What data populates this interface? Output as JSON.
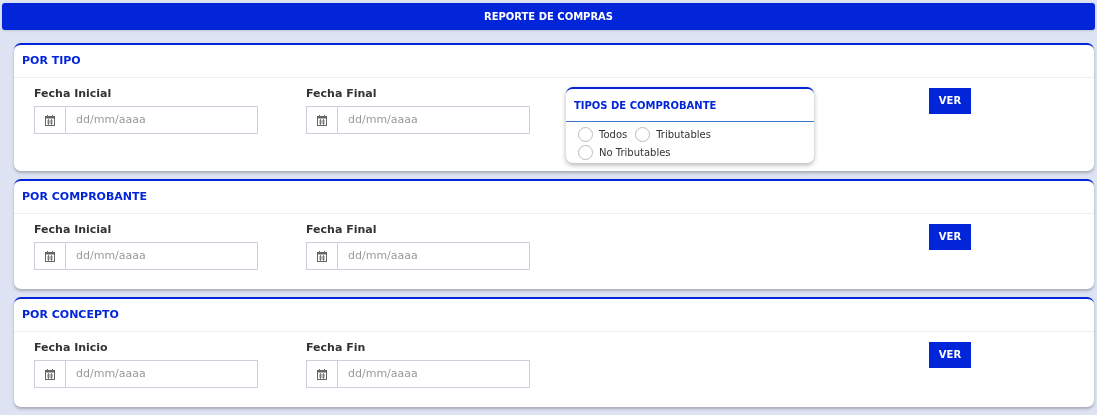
{
  "header": {
    "title": "REPORTE DE COMPRAS"
  },
  "sections": [
    {
      "title": "POR TIPO",
      "fields": [
        {
          "label": "Fecha Inicial",
          "placeholder": "dd/mm/aaaa"
        },
        {
          "label": "Fecha Final",
          "placeholder": "dd/mm/aaaa"
        }
      ],
      "type_panel": {
        "title": "TIPOS DE COMPROBANTE",
        "options": [
          {
            "label": "Todos",
            "selected": false
          },
          {
            "label": "Tributables",
            "selected": false
          },
          {
            "label": "No Tributables",
            "selected": false
          }
        ]
      },
      "button": "VER"
    },
    {
      "title": "POR COMPROBANTE",
      "fields": [
        {
          "label": "Fecha Inicial",
          "placeholder": "dd/mm/aaaa"
        },
        {
          "label": "Fecha Final",
          "placeholder": "dd/mm/aaaa"
        }
      ],
      "button": "VER"
    },
    {
      "title": "POR CONCEPTO",
      "fields": [
        {
          "label": "Fecha Inicio",
          "placeholder": "dd/mm/aaaa"
        },
        {
          "label": "Fecha Fin",
          "placeholder": "dd/mm/aaaa"
        }
      ],
      "button": "VER"
    }
  ]
}
